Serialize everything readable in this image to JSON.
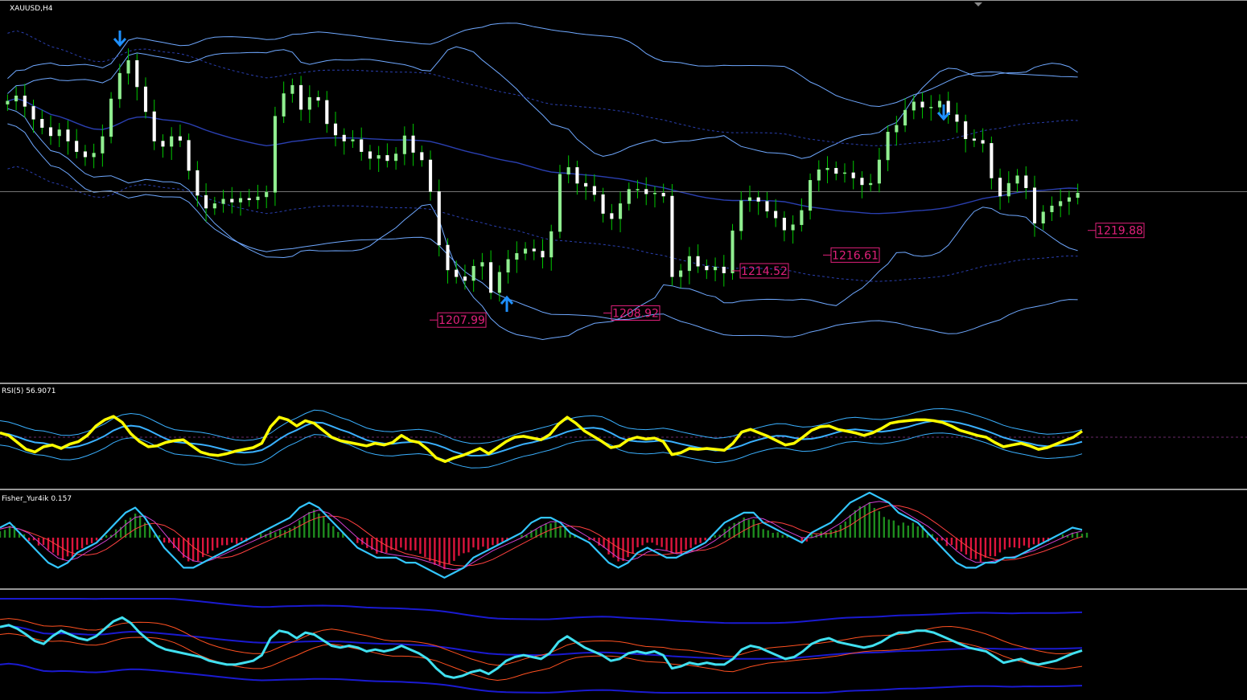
{
  "window": {
    "symbol_label": "XAUUSD,H4"
  },
  "colors": {
    "background": "#000000",
    "bull_candle": "#90ee90",
    "bear_candle": "#ffffff",
    "candle_wick": "#00c800",
    "bollinger": "#6fa8ff",
    "envelope": "#2a3fb0",
    "price_label": "#e0207a",
    "arrow": "#1e90ff",
    "rsi_main": "#ffff00",
    "rsi_band": "#3ab0ff",
    "fisher_line": "#33c6ff",
    "fisher_pos_hist": "#1e8c1e",
    "fisher_neg_hist": "#dc143c",
    "fisher_signal": "#ff4040",
    "fisher_signal2": "#d040d0",
    "bottom_main": "#40e0f0",
    "bottom_ma": "#ff5020",
    "bottom_band": "#1a1ad0"
  },
  "chart_data": [
    {
      "type": "line",
      "panel": "price",
      "title": "XAUUSD,H4",
      "series_kind": "candlestick",
      "ylim": [
        1203,
        1248
      ],
      "current_price_line": 1224.5,
      "closes": [
        1236.5,
        1237.2,
        1235.8,
        1234.1,
        1233.0,
        1231.9,
        1232.7,
        1231.2,
        1229.8,
        1229.1,
        1229.6,
        1231.8,
        1236.8,
        1240.2,
        1241.9,
        1238.4,
        1235.1,
        1231.2,
        1230.5,
        1231.8,
        1231.3,
        1227.3,
        1224.0,
        1222.3,
        1222.9,
        1223.5,
        1223.1,
        1223.6,
        1223.4,
        1223.8,
        1224.4,
        1234.5,
        1237.5,
        1238.6,
        1235.4,
        1237.0,
        1236.6,
        1233.5,
        1232.0,
        1231.2,
        1231.4,
        1229.8,
        1228.9,
        1229.3,
        1228.6,
        1229.5,
        1231.9,
        1229.7,
        1228.7,
        1224.5,
        1217.4,
        1214.1,
        1213.2,
        1212.7,
        1214.6,
        1215.1,
        1211.1,
        1213.8,
        1215.5,
        1216.3,
        1216.9,
        1216.6,
        1215.8,
        1219.2,
        1226.8,
        1227.7,
        1225.6,
        1225.2,
        1224.1,
        1221.6,
        1220.9,
        1222.9,
        1224.8,
        1224.8,
        1224.2,
        1224.3,
        1223.9,
        1213.2,
        1214.0,
        1215.9,
        1214.6,
        1214.1,
        1214.5,
        1213.7,
        1219.3,
        1223.3,
        1223.7,
        1223.2,
        1221.9,
        1221.0,
        1219.4,
        1220.1,
        1222.0,
        1226.0,
        1227.4,
        1227.6,
        1226.9,
        1227.0,
        1226.3,
        1225.4,
        1225.6,
        1228.7,
        1232.4,
        1233.3,
        1235.3,
        1236.4,
        1235.7,
        1235.7,
        1236.5,
        1234.7,
        1233.8,
        1231.5,
        1231.3,
        1230.9,
        1226.3,
        1223.9,
        1225.6,
        1226.6,
        1225.0,
        1220.3,
        1221.8,
        1222.6,
        1223.2,
        1223.7,
        1224.3
      ],
      "annotations": {
        "price_labels": [
          {
            "text": "1207.99",
            "value": 1207.99
          },
          {
            "text": "1208.92",
            "value": 1208.92
          },
          {
            "text": "1214.52",
            "value": 1214.52
          },
          {
            "text": "1216.61",
            "value": 1216.61
          },
          {
            "text": "1219.88",
            "value": 1219.88
          }
        ],
        "arrows": [
          {
            "direction": "down",
            "bar": 26
          },
          {
            "direction": "up",
            "bar": 113
          },
          {
            "direction": "down",
            "bar": 211
          }
        ]
      },
      "overlays": [
        "Bollinger Bands",
        "Envelopes"
      ]
    },
    {
      "type": "line",
      "panel": "rsi",
      "title": "RSI(5) 56.9071",
      "ylim": [
        0,
        100
      ],
      "level": 50,
      "series": [
        {
          "values": [
            55,
            52,
            44,
            36,
            33,
            39,
            41,
            37,
            42,
            45,
            52,
            63,
            70,
            74,
            67,
            54,
            45,
            39,
            40,
            44,
            46,
            47,
            40,
            33,
            30,
            29,
            31,
            34,
            36,
            38,
            43,
            62,
            73,
            70,
            63,
            69,
            66,
            58,
            50,
            46,
            44,
            42,
            40,
            43,
            41,
            44,
            52,
            46,
            44,
            36,
            26,
            22,
            26,
            29,
            33,
            37,
            31,
            38,
            45,
            50,
            51,
            49,
            47,
            53,
            65,
            73,
            66,
            57,
            51,
            45,
            38,
            40,
            47,
            50,
            48,
            49,
            45,
            30,
            32,
            37,
            36,
            37,
            36,
            35,
            43,
            56,
            59,
            55,
            51,
            46,
            41,
            43,
            50,
            58,
            62,
            63,
            59,
            57,
            55,
            52,
            55,
            60,
            66,
            68,
            69,
            70,
            70,
            69,
            67,
            63,
            58,
            55,
            52,
            50,
            44,
            39,
            41,
            43,
            40,
            36,
            38,
            42,
            46,
            50,
            56.9
          ]
        }
      ]
    },
    {
      "type": "bar",
      "panel": "fisher",
      "title": "Fisher_Yur4ik 0.157",
      "ylim": [
        -1,
        1
      ],
      "series": [
        {
          "values": [
            0.2,
            0.3,
            0.1,
            -0.1,
            -0.3,
            -0.5,
            -0.6,
            -0.5,
            -0.3,
            -0.2,
            -0.1,
            0.1,
            0.3,
            0.5,
            0.6,
            0.4,
            0.1,
            -0.2,
            -0.4,
            -0.6,
            -0.6,
            -0.5,
            -0.4,
            -0.3,
            -0.2,
            -0.1,
            0.0,
            0.1,
            0.2,
            0.3,
            0.4,
            0.6,
            0.7,
            0.6,
            0.4,
            0.2,
            0.0,
            -0.2,
            -0.3,
            -0.4,
            -0.4,
            -0.4,
            -0.5,
            -0.5,
            -0.6,
            -0.7,
            -0.8,
            -0.7,
            -0.6,
            -0.4,
            -0.3,
            -0.2,
            -0.1,
            0.0,
            0.1,
            0.3,
            0.4,
            0.4,
            0.3,
            0.1,
            0.0,
            -0.1,
            -0.3,
            -0.5,
            -0.6,
            -0.5,
            -0.3,
            -0.2,
            -0.3,
            -0.4,
            -0.4,
            -0.3,
            -0.2,
            -0.1,
            0.1,
            0.3,
            0.4,
            0.5,
            0.5,
            0.3,
            0.2,
            0.1,
            0.0,
            -0.1,
            0.1,
            0.2,
            0.3,
            0.5,
            0.7,
            0.8,
            0.9,
            0.8,
            0.7,
            0.5,
            0.4,
            0.3,
            0.1,
            -0.1,
            -0.3,
            -0.5,
            -0.6,
            -0.6,
            -0.5,
            -0.5,
            -0.4,
            -0.4,
            -0.3,
            -0.2,
            -0.1,
            0.0,
            0.1,
            0.2,
            0.157
          ]
        }
      ]
    },
    {
      "type": "line",
      "panel": "bottom",
      "title": "",
      "ylim": [
        0,
        100
      ],
      "series": [
        {
          "values": [
            70,
            72,
            68,
            62,
            55,
            52,
            60,
            66,
            62,
            58,
            56,
            60,
            68,
            76,
            80,
            74,
            64,
            56,
            50,
            46,
            44,
            42,
            40,
            38,
            34,
            32,
            30,
            30,
            32,
            34,
            40,
            58,
            66,
            64,
            58,
            64,
            62,
            56,
            50,
            48,
            50,
            48,
            44,
            46,
            44,
            46,
            50,
            46,
            42,
            36,
            26,
            18,
            16,
            18,
            22,
            24,
            20,
            26,
            34,
            38,
            40,
            38,
            36,
            42,
            54,
            60,
            54,
            48,
            44,
            40,
            34,
            36,
            42,
            44,
            42,
            44,
            40,
            26,
            28,
            32,
            30,
            32,
            30,
            30,
            36,
            46,
            50,
            48,
            44,
            40,
            36,
            38,
            44,
            52,
            56,
            58,
            54,
            52,
            50,
            48,
            50,
            54,
            60,
            64,
            64,
            66,
            66,
            64,
            60,
            56,
            52,
            48,
            46,
            44,
            38,
            32,
            34,
            36,
            32,
            30,
            32,
            34,
            38,
            42,
            45
          ]
        }
      ]
    }
  ]
}
